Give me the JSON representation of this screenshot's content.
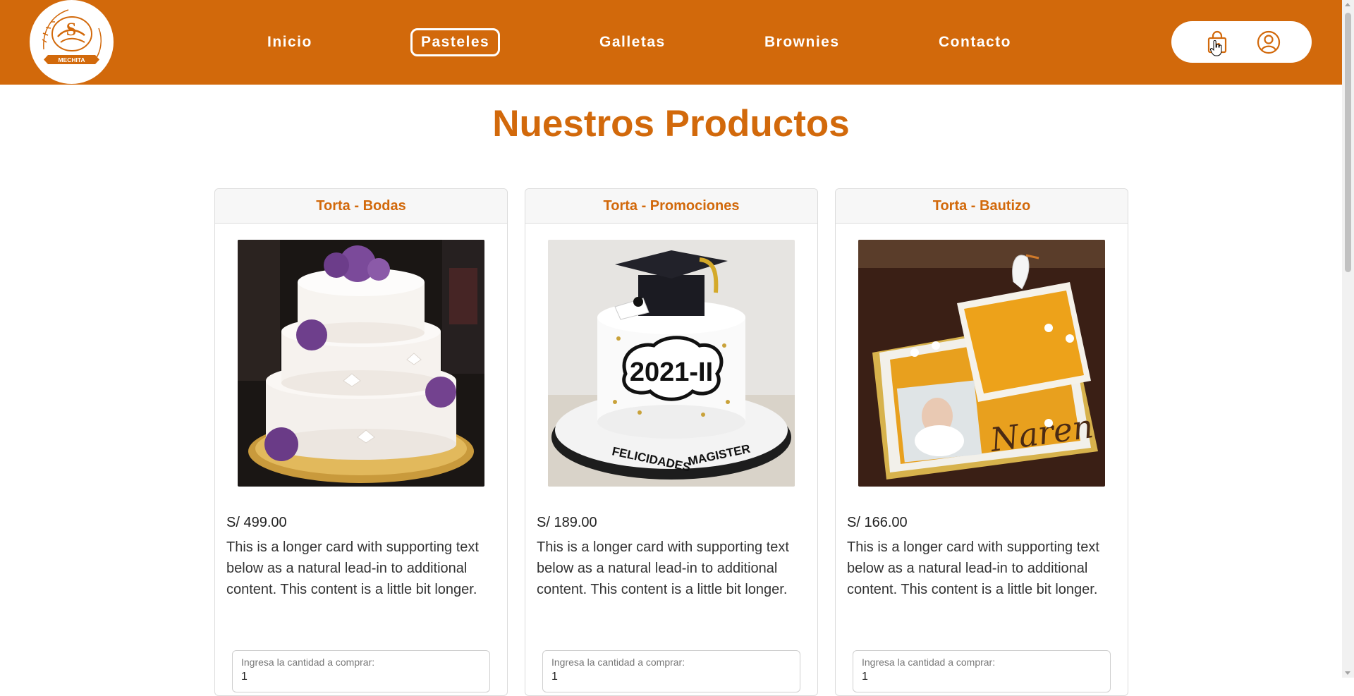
{
  "brand": {
    "logo_text": "MECHITA",
    "accent": "#D2690B"
  },
  "nav": {
    "links": [
      {
        "label": "Inicio",
        "active": false
      },
      {
        "label": "Pasteles",
        "active": true
      },
      {
        "label": "Galletas",
        "active": false
      },
      {
        "label": "Brownies",
        "active": false
      },
      {
        "label": "Contacto",
        "active": false
      }
    ],
    "actions": [
      {
        "icon": "shopping-bag-icon"
      },
      {
        "icon": "user-circle-icon"
      }
    ]
  },
  "main": {
    "title": "Nuestros Productos",
    "products": [
      {
        "name": "Torta - Bodas",
        "image": "wedding-cake-image",
        "price": "S/ 499.00",
        "description": "This is a longer card with supporting text below as a natural lead-in to additional content. This content is a little bit longer.",
        "quantity_label": "Ingresa la cantidad a comprar:",
        "quantity_value": "1"
      },
      {
        "name": "Torta - Promociones",
        "image": "graduation-cake-image",
        "price": "S/ 189.00",
        "description": "This is a longer card with supporting text below as a natural lead-in to additional content. This content is a little bit longer.",
        "quantity_label": "Ingresa la cantidad a comprar:",
        "quantity_value": "1"
      },
      {
        "name": "Torta - Bautizo",
        "image": "baptism-cake-image",
        "price": "S/ 166.00",
        "description": "This is a longer card with supporting text below as a natural lead-in to additional content. This content is a little bit longer.",
        "quantity_label": "Ingresa la cantidad a comprar:",
        "quantity_value": "1"
      }
    ],
    "image_text": {
      "grad_year": "2021-II",
      "grad_line_1": "FELICIDADES",
      "grad_line_2": "MAGISTER",
      "baptism_name": "Naren"
    }
  }
}
